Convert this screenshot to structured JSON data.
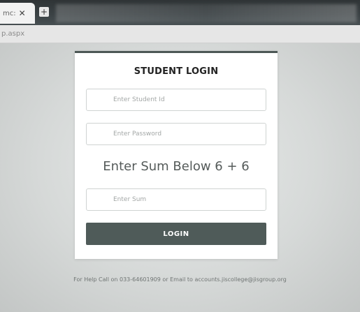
{
  "browser": {
    "tab_title": "mc:",
    "tab_close": "✕",
    "newtab_icon": "+",
    "url": "p.aspx"
  },
  "login": {
    "title": "STUDENT LOGIN",
    "student_id_placeholder": "Enter Student Id",
    "password_placeholder": "Enter Password",
    "sum_label": "Enter Sum Below 6 + 6",
    "sum_placeholder": "Enter Sum",
    "login_button": "LOGIN"
  },
  "footer": {
    "help_text": "For Help Call on 033-64601909 or Email to accounts.jiscollege@jisgroup.org"
  },
  "colors": {
    "card_accent": "#4d5856",
    "button": "#4f5b59"
  }
}
